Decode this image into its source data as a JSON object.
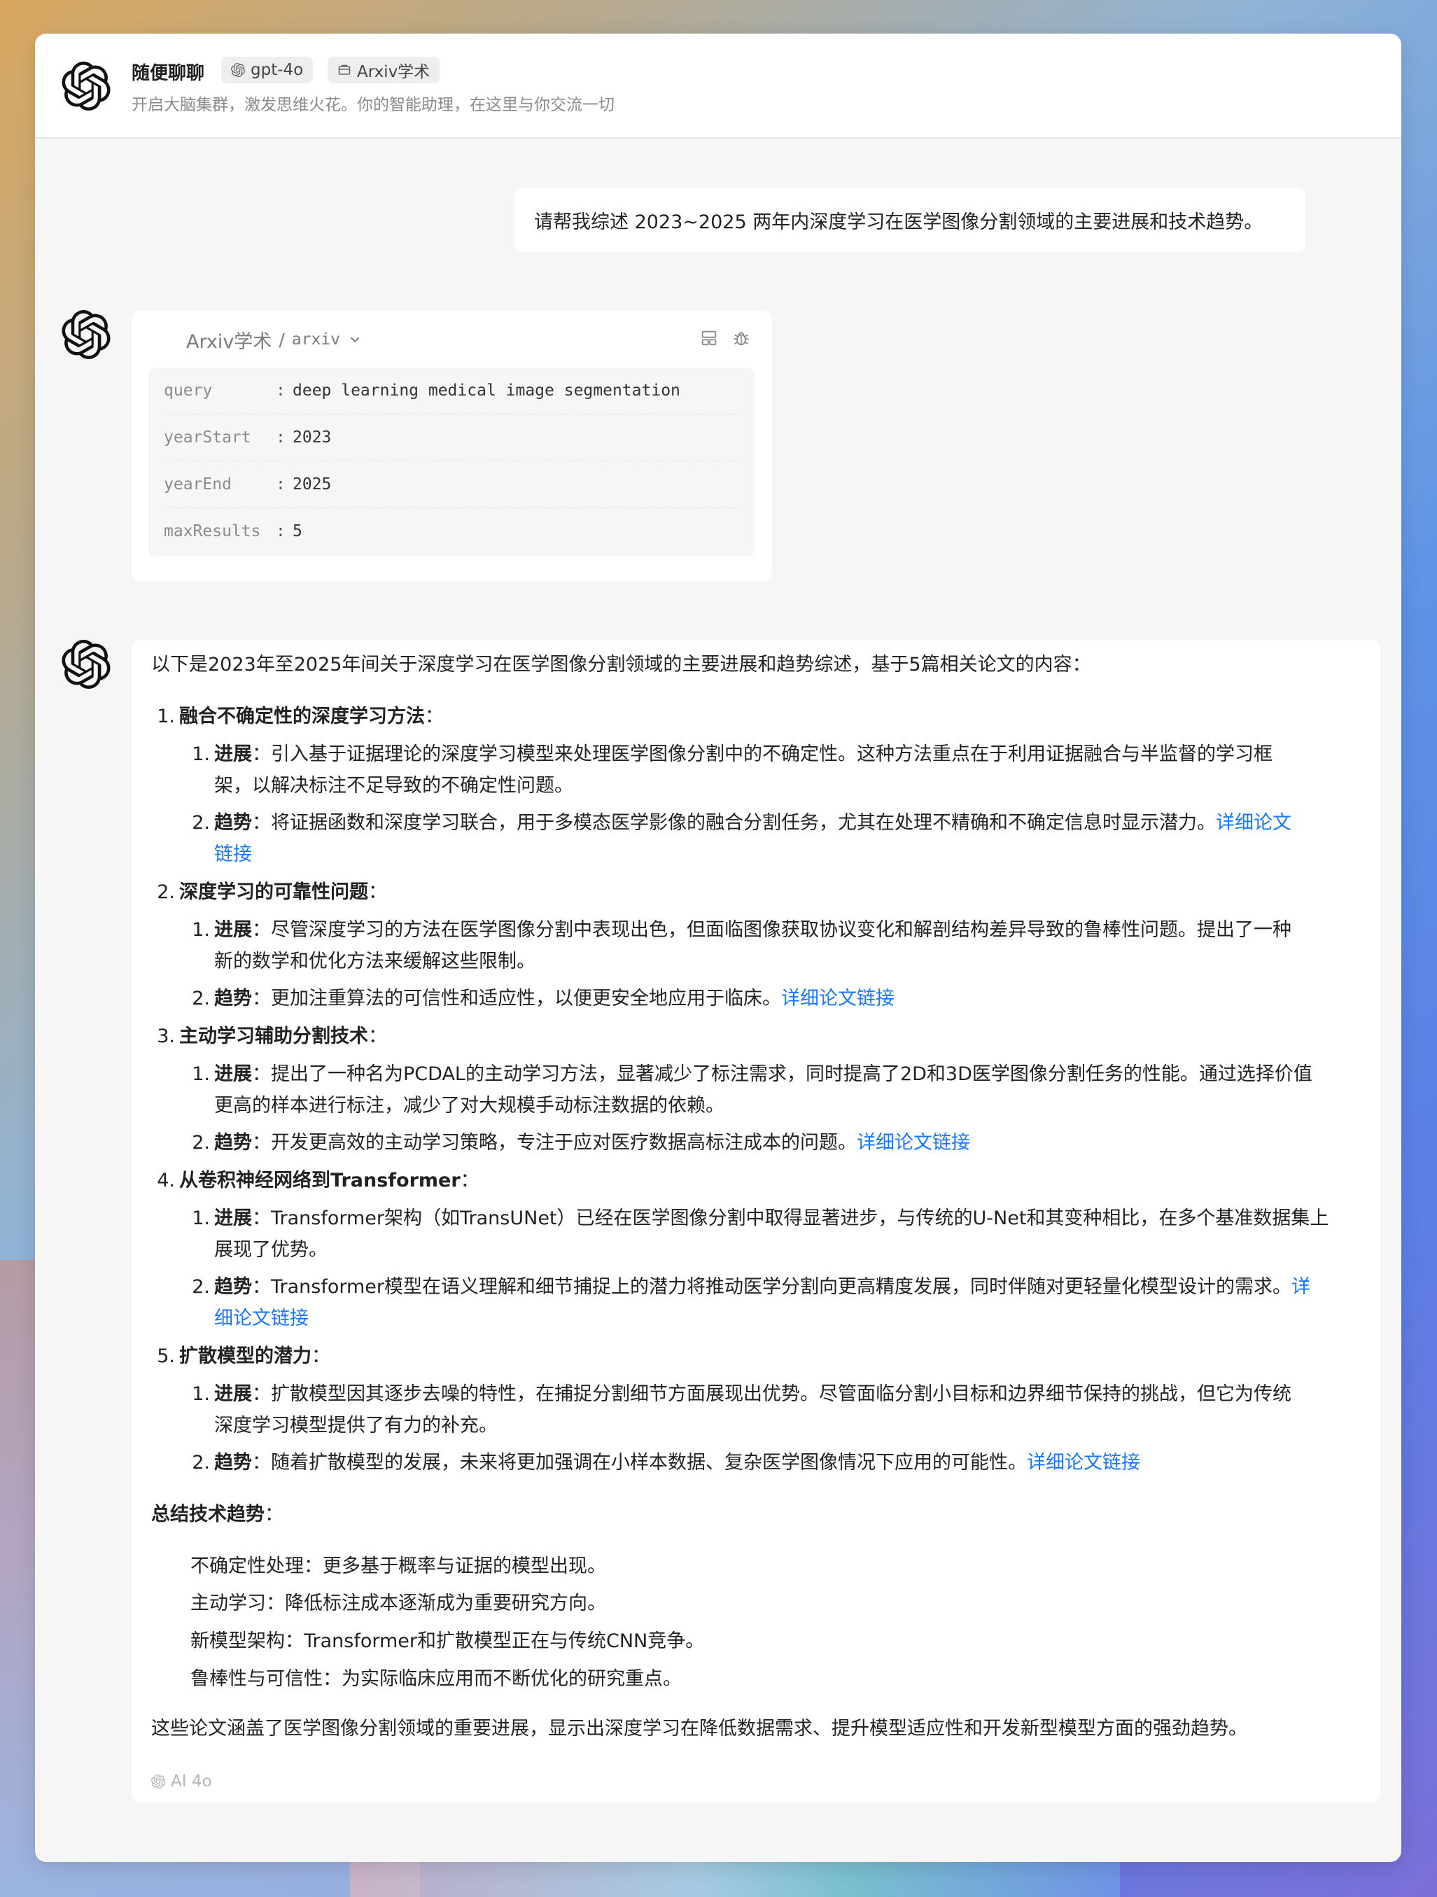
{
  "header": {
    "title": "随便聊聊",
    "model_chip": "gpt-4o",
    "plugin_chip": "Arxiv学术",
    "subtitle": "开启大脑集群，激发思维火花。你的智能助理，在这里与你交流一切"
  },
  "user_message": "请帮我综述 2023~2025 两年内深度学习在医学图像分割领域的主要进展和技术趋势。",
  "tool_call": {
    "plugin_name": "Arxiv学术",
    "separator": "/",
    "identifier": "arxiv",
    "params": [
      {
        "key": "query",
        "value": "deep learning medical image segmentation"
      },
      {
        "key": "yearStart",
        "value": "2023"
      },
      {
        "key": "yearEnd",
        "value": "2025"
      },
      {
        "key": "maxResults",
        "value": "5"
      }
    ]
  },
  "answer": {
    "intro": "以下是2023年至2025年间关于深度学习在医学图像分割领域的主要进展和趋势综述，基于5篇相关论文的内容：",
    "sections": [
      {
        "num": "1.",
        "title": "融合不确定性的深度学习方法",
        "colon": "：",
        "progress_label": "进展",
        "progress_line1": "：引入基于证据理论的深度学习模型来处理医学图像分割中的不确定性。这种方法重点在于利用证据融合与半监督的学习框",
        "progress_line2": "架，以解决标注不足导致的不确定性问题。",
        "trend_label": "趋势",
        "trend_line1": "：将证据函数和深度学习联合，用于多模态医学影像的融合分割任务，尤其在处理不精确和不确定信息时显示潜力。",
        "trend_link1": "详细论文",
        "trend_line2_text": "",
        "trend_link2": "链接"
      },
      {
        "num": "2.",
        "title": "深度学习的可靠性问题",
        "colon": "：",
        "progress_label": "进展",
        "progress_line1": "：尽管深度学习的方法在医学图像分割中表现出色，但面临图像获取协议变化和解剖结构差异导致的鲁棒性问题。提出了一种",
        "progress_line2": "新的数学和优化方法来缓解这些限制。",
        "trend_label": "趋势",
        "trend_line1": "：更加注重算法的可信性和适应性，以便更安全地应用于临床。",
        "trend_link1": "详细论文链接"
      },
      {
        "num": "3.",
        "title": "主动学习辅助分割技术",
        "colon": "：",
        "progress_label": "进展",
        "progress_line1": "：提出了一种名为PCDAL的主动学习方法，显著减少了标注需求，同时提高了2D和3D医学图像分割任务的性能。通过选择价值",
        "progress_line2": "更高的样本进行标注，减少了对大规模手动标注数据的依赖。",
        "trend_label": "趋势",
        "trend_line1": "：开发更高效的主动学习策略，专注于应对医疗数据高标注成本的问题。",
        "trend_link1": "详细论文链接"
      },
      {
        "num": "4.",
        "title": "从卷积神经网络到Transformer",
        "colon": "：",
        "progress_label": "进展",
        "progress_line1": "：Transformer架构（如TransUNet）已经在医学图像分割中取得显著进步，与传统的U-Net和其变种相比，在多个基准数据集上",
        "progress_line2": "展现了优势。",
        "trend_label": "趋势",
        "trend_line1": "：Transformer模型在语义理解和细节捕捉上的潜力将推动医学分割向更高精度发展，同时伴随对更轻量化模型设计的需求。",
        "trend_link1": "详",
        "trend_link2": "细论文链接"
      },
      {
        "num": "5.",
        "title": "扩散模型的潜力",
        "colon": "：",
        "progress_label": "进展",
        "progress_line1": "：扩散模型因其逐步去噪的特性，在捕捉分割细节方面展现出优势。尽管面临分割小目标和边界细节保持的挑战，但它为传统",
        "progress_line2": "深度学习模型提供了有力的补充。",
        "trend_label": "趋势",
        "trend_line1": "：随着扩散模型的发展，未来将更加强调在小样本数据、复杂医学图像情况下应用的可能性。",
        "trend_link1": "详细论文链接"
      }
    ],
    "summary_title": "总结技术趋势",
    "summary_colon": "：",
    "summary_items": [
      "不确定性处理：更多基于概率与证据的模型出现。",
      "主动学习：降低标注成本逐渐成为重要研究方向。",
      "新模型架构：Transformer和扩散模型正在与传统CNN竞争。",
      "鲁棒性与可信性：为实际临床应用而不断优化的研究重点。"
    ],
    "conclusion": "这些论文涵盖了医学图像分割领域的重要进展，显示出深度学习在降低数据需求、提升模型适应性和开发新型模型方面的强劲趋势。",
    "footer_model": "AI 4o"
  },
  "sub_numbers": [
    "1.",
    "2."
  ],
  "colors": {
    "link": "#1677ff",
    "card_bg": "#ffffff",
    "window_bg": "#f6f6f7"
  }
}
